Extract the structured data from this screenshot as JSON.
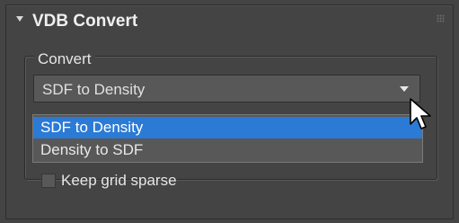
{
  "rollout": {
    "title": "VDB Convert"
  },
  "convert_group": {
    "label": "Convert",
    "combo": {
      "selected_value": "SDF to Density"
    },
    "dropdown": {
      "options": [
        "SDF to Density",
        "Density to SDF"
      ],
      "highlighted_option": "SDF to Density"
    }
  },
  "keep_sparse": {
    "label": "Keep grid sparse",
    "checked": false
  },
  "colors": {
    "panel_bg": "#444444",
    "highlight": "#2b7ad5",
    "control_bg": "#585858"
  },
  "icons": {
    "collapse": "triangle-down-icon",
    "grip": "grip-dots-icon",
    "combo_arrow": "chevron-down-icon",
    "cursor": "mouse-pointer-icon"
  }
}
